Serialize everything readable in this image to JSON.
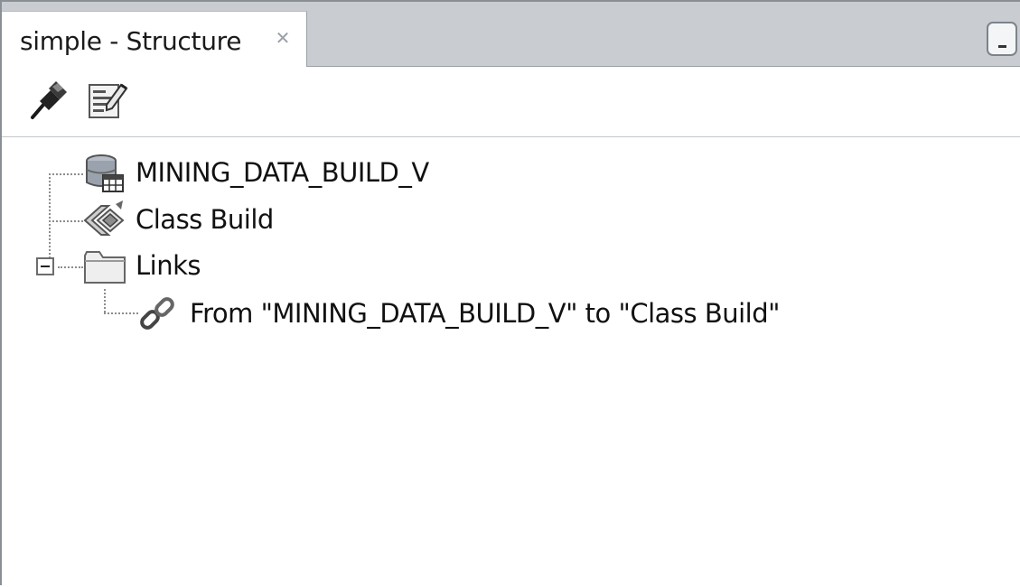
{
  "window": {
    "tab_title": "simple - Structure",
    "tab_close_glyph": "✕"
  },
  "toolbar": {
    "buttons": [
      {
        "name": "pin-icon"
      },
      {
        "name": "properties-icon"
      }
    ]
  },
  "tree": {
    "nodes": [
      {
        "label": "MINING_DATA_BUILD_V",
        "icon": "data-source-icon",
        "level": 0
      },
      {
        "label": "Class Build",
        "icon": "class-build-icon",
        "level": 0
      },
      {
        "label": "Links",
        "icon": "folder-icon",
        "level": 0,
        "expanded": true
      },
      {
        "label": "From \"MINING_DATA_BUILD_V\" to \"Class Build\"",
        "icon": "link-icon",
        "level": 1
      }
    ]
  },
  "colors": {
    "tab_strip_bg": "#c9cdd2",
    "panel_bg": "#ffffff",
    "tree_line": "#8d8d8d"
  }
}
